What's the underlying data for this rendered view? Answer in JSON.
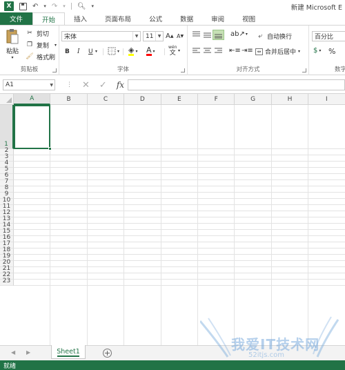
{
  "app": {
    "logo": "X",
    "title": "新建 Microsoft E"
  },
  "tabs": [
    {
      "label": "文件"
    },
    {
      "label": "开始"
    },
    {
      "label": "插入"
    },
    {
      "label": "页面布局"
    },
    {
      "label": "公式"
    },
    {
      "label": "数据"
    },
    {
      "label": "审阅"
    },
    {
      "label": "视图"
    }
  ],
  "ribbon": {
    "clipboard": {
      "label": "剪贴板",
      "paste": "粘贴",
      "cut": "剪切",
      "copy": "复制",
      "format_painter": "格式刷"
    },
    "font": {
      "label": "字体",
      "font_name": "宋体",
      "font_size": "11",
      "grow": "A",
      "shrink": "A",
      "bold": "B",
      "italic": "I",
      "underline": "U",
      "wen": "wén",
      "font_color_letter": "A"
    },
    "alignment": {
      "label": "对齐方式",
      "wrap_text": "自动换行",
      "merge_center": "合并后居中"
    },
    "number": {
      "label": "数字",
      "format": "百分比",
      "percent": "%"
    }
  },
  "formula_bar": {
    "name_box": "A1",
    "fx": "fx",
    "value": ""
  },
  "columns": [
    "A",
    "B",
    "C",
    "D",
    "E",
    "F",
    "G",
    "H",
    "I"
  ],
  "rows": [
    "1",
    "2",
    "3",
    "4",
    "5",
    "6",
    "7",
    "8",
    "9",
    "10",
    "11",
    "12",
    "13",
    "14",
    "15",
    "16",
    "17",
    "18",
    "19",
    "20",
    "21",
    "22",
    "23"
  ],
  "sheets": [
    {
      "label": "Sheet1"
    }
  ],
  "add_sheet": "+",
  "status": {
    "text": "就绪"
  },
  "watermark": {
    "text": "我爱IT技术网",
    "url": "52itjs.com"
  },
  "colors": {
    "accent": "#217346"
  }
}
